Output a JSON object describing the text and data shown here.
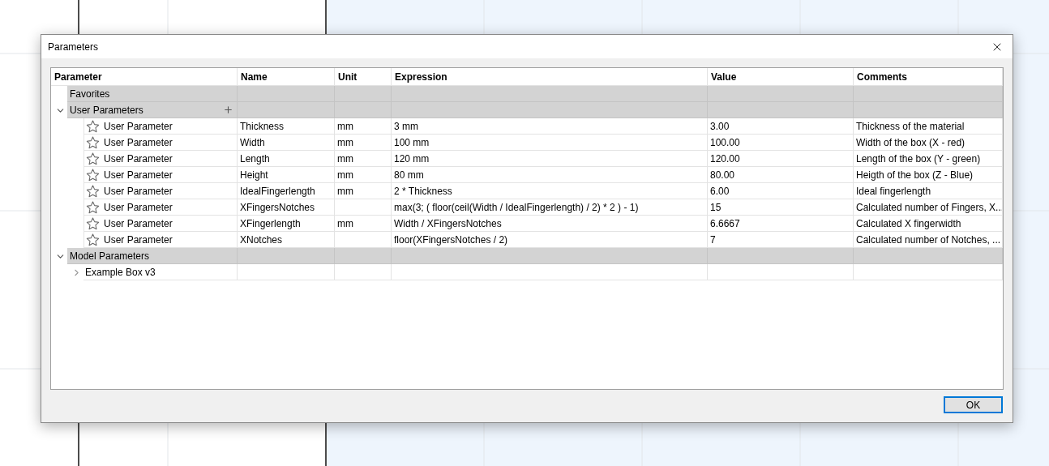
{
  "dialog": {
    "title": "Parameters"
  },
  "table": {
    "columns": [
      "Parameter",
      "Name",
      "Unit",
      "Expression",
      "Value",
      "Comments"
    ],
    "groups": [
      {
        "label": "Favorites"
      },
      {
        "label": "User Parameters",
        "expanded": true,
        "addable": true,
        "children": [
          {
            "type": "User Parameter",
            "favorite": false,
            "name": "Thickness",
            "unit": "mm",
            "expression": "3 mm",
            "value": "3.00",
            "comment": "Thickness of the material"
          },
          {
            "type": "User Parameter",
            "favorite": false,
            "name": "Width",
            "unit": "mm",
            "expression": "100 mm",
            "value": "100.00",
            "comment": "Width of the box (X - red)"
          },
          {
            "type": "User Parameter",
            "favorite": false,
            "name": "Length",
            "unit": "mm",
            "expression": "120 mm",
            "value": "120.00",
            "comment": "Length of the box (Y - green)"
          },
          {
            "type": "User Parameter",
            "favorite": false,
            "name": "Height",
            "unit": "mm",
            "expression": "80 mm",
            "value": "80.00",
            "comment": "Heigth of the box (Z - Blue)"
          },
          {
            "type": "User Parameter",
            "favorite": false,
            "name": "IdealFingerlength",
            "unit": "mm",
            "expression": "2 * Thickness",
            "value": "6.00",
            "comment": "Ideal fingerlength"
          },
          {
            "type": "User Parameter",
            "favorite": false,
            "name": "XFingersNotches",
            "expression": "max(3; ( floor(ceil(Width / IdealFingerlength) / 2) * 2 ) - 1)",
            "value": "15",
            "comment": "Calculated number of Fingers, X..."
          },
          {
            "type": "User Parameter",
            "favorite": false,
            "name": "XFingerlength",
            "unit": "mm",
            "expression": "Width / XFingersNotches",
            "value": "6.6667",
            "comment": "Calculated X fingerwidth"
          },
          {
            "type": "User Parameter",
            "favorite": false,
            "name": "XNotches",
            "expression": "floor(XFingersNotches / 2)",
            "value": "7",
            "comment": "Calculated number of Notches, ..."
          }
        ]
      },
      {
        "label": "Model Parameters",
        "expanded": true,
        "children": [
          {
            "kind": "component",
            "label": "Example Box v3",
            "expanded": false
          }
        ]
      }
    ]
  },
  "buttons": [
    "OK"
  ]
}
